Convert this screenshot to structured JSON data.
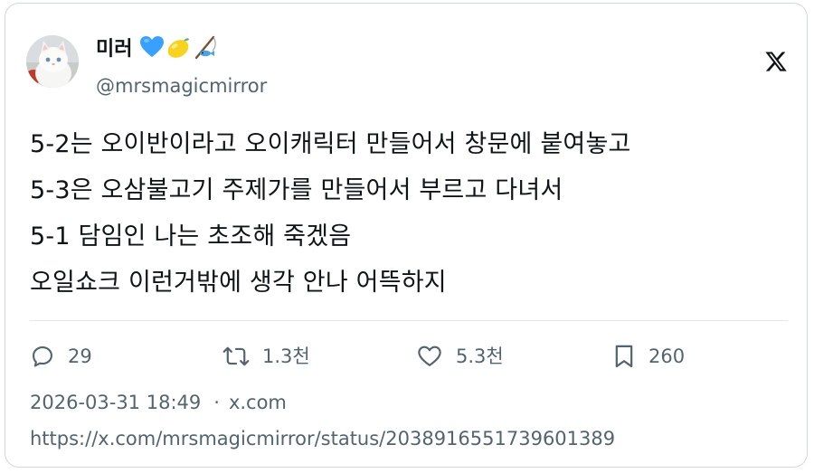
{
  "tweet": {
    "author": {
      "display_name": "미러",
      "name_emojis": [
        "blue-heart-icon",
        "lemon-icon",
        "fishing-pole-icon"
      ],
      "handle": "@mrsmagicmirror"
    },
    "lines": [
      "5-2는 오이반이라고 오이캐릭터 만들어서 창문에 붙여놓고",
      "5-3은 오삼불고기 주제가를 만들어서 부르고 다녀서",
      "5-1 담임인 나는 초조해 죽겠음",
      "오일쇼크 이런거밖에 생각 안나 어뜩하지"
    ],
    "stats": {
      "replies": "29",
      "retweets": "1.3천",
      "likes": "5.3천",
      "bookmarks": "260"
    },
    "timestamp": "2026-03-31 18:49",
    "separator": "·",
    "source": "x.com",
    "url": "https://x.com/mrsmagicmirror/status/2038916551739601389"
  },
  "colors": {
    "text_primary": "#0f1419",
    "text_secondary": "#536471",
    "border": "#cfd9de",
    "heart_blue": "#3aa0ff",
    "lemon_yellow": "#f7d21f"
  }
}
